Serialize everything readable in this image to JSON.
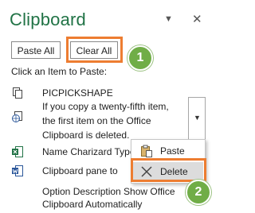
{
  "pane": {
    "title": "Clipboard",
    "icons": {
      "options": "dropdown-triangle-icon",
      "close": "close-icon"
    }
  },
  "toolbar": {
    "paste_all_label": "Paste All",
    "clear_all_label": "Clear All"
  },
  "instruction": "Click an Item to Paste:",
  "items": [
    {
      "icon": "clipboard-copy-icon",
      "lines": [
        "PICPICKSHAPE"
      ]
    },
    {
      "icon": "office-globe-icon",
      "lines": [
        "If you copy a twenty-fifth item,",
        "the first item on the Office",
        "Clipboard is deleted."
      ]
    },
    {
      "icon": "excel-icon",
      "lines": [
        "Name Charizard Type"
      ]
    },
    {
      "icon": "word-icon",
      "lines": [
        "Clipboard pane to"
      ]
    },
    {
      "icon": "none",
      "lines": [
        "Option Description Show Office",
        "Clipboard Automatically"
      ]
    }
  ],
  "context_menu": {
    "items": [
      {
        "label": "Paste",
        "icon": "paste-icon"
      },
      {
        "label": "Delete",
        "icon": "delete-x-icon"
      }
    ]
  },
  "callouts": [
    {
      "number": "1"
    },
    {
      "number": "2"
    }
  ],
  "colors": {
    "title": "#217346",
    "highlight": "#ed7d31",
    "badge": "#70ad47",
    "menu_hover": "#dcdcdc"
  }
}
